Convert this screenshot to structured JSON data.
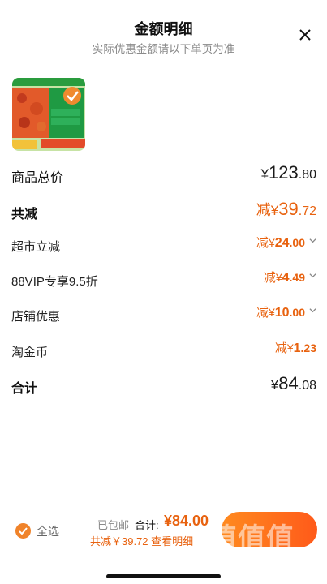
{
  "header": {
    "title": "金额明细",
    "subtitle": "实际优惠金额请以下单页为准",
    "close_icon": "close-icon"
  },
  "product": {
    "thumbnail_icon": "product-thumbnail"
  },
  "rows": {
    "subtotal": {
      "label": "商品总价",
      "currency": "¥",
      "int": "123",
      "dec": ".80"
    },
    "discount_total": {
      "label": "共减",
      "prefix": "减",
      "currency": "¥",
      "int": "39",
      "dec": ".72"
    },
    "supermarket": {
      "label": "超市立减",
      "prefix": "减",
      "currency": "¥",
      "int": "24",
      "dec": ".00"
    },
    "vip": {
      "label": "88VIP专享9.5折",
      "prefix": "减",
      "currency": "¥",
      "int": "4",
      "dec": ".49"
    },
    "store": {
      "label": "店铺优惠",
      "prefix": "减",
      "currency": "¥",
      "int": "10",
      "dec": ".00"
    },
    "taojinbi": {
      "label": "淘金币",
      "prefix": "减",
      "currency": "¥",
      "int": "1",
      "dec": ".23"
    },
    "total": {
      "label": "合计",
      "currency": "¥",
      "int": "84",
      "dec": ".08"
    }
  },
  "footer": {
    "select_all": "全选",
    "shipping": "已包邮",
    "total_label": "合计:",
    "total_value": "¥84.00",
    "saved_text": "共减￥39.72 查看明细",
    "pay_button_color": "#ff6a1a",
    "watermark": "值值值",
    "watermark_url": "zhizhizhi.com"
  },
  "colors": {
    "accent": "#e8620f",
    "text": "#111111",
    "muted": "#8a8a8a"
  }
}
